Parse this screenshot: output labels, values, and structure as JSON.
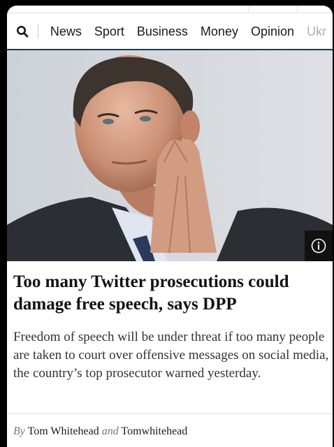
{
  "nav": {
    "items": [
      "News",
      "Sport",
      "Business",
      "Money",
      "Opinion",
      "Ukr"
    ],
    "search_icon": "search-icon"
  },
  "hero": {
    "info_icon": "info-icon"
  },
  "article": {
    "headline": "Too many Twitter prosecutions could damage free speech, says DPP",
    "standfirst": "Freedom of speech will be under threat if too many people are taken to court over offensive messages on social media, the country’s top prosecutor warned yesterday.",
    "byline": {
      "by": "By",
      "author1": "Tom Whitehead",
      "and": "and",
      "author2": "Tomwhitehead"
    }
  },
  "colors": {
    "nav_rule": "#1f3a4a",
    "headline": "#121212",
    "info_button": "#111111"
  }
}
